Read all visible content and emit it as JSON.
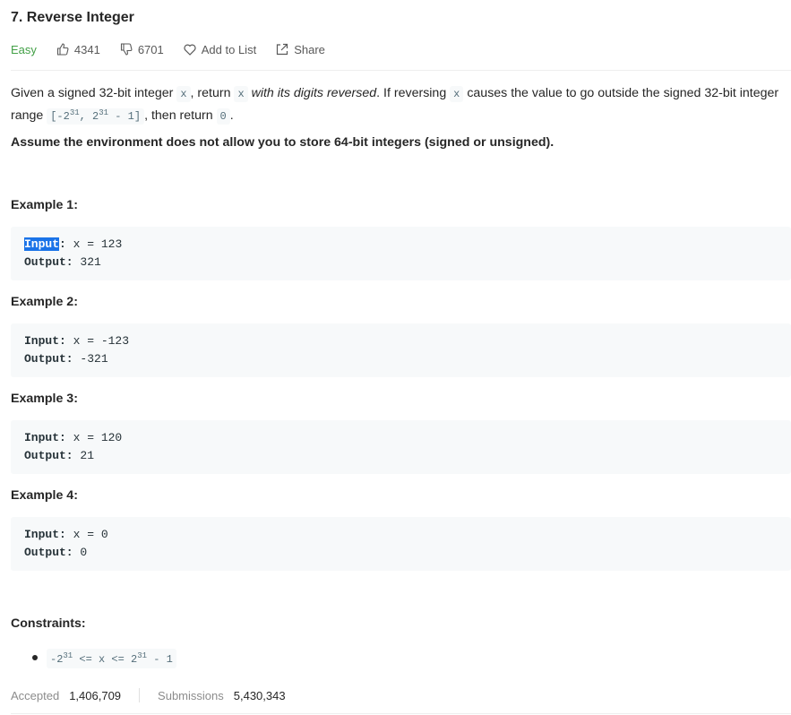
{
  "problem": {
    "title": "7. Reverse Integer",
    "difficulty": "Easy",
    "likes": "4341",
    "dislikes": "6701",
    "add_to_list": "Add to List",
    "share": "Share"
  },
  "description": {
    "p1_a": "Given a signed 32-bit integer ",
    "p1_code1": "x",
    "p1_b": ", return ",
    "p1_code2": "x",
    "p1_em": "with its digits reversed",
    "p1_c": ". If reversing ",
    "p1_code3": "x",
    "p1_d": " causes the value to go outside the signed 32-bit integer range ",
    "range_open": "[-2",
    "range_exp1": "31",
    "range_mid": ", 2",
    "range_exp2": "31",
    "range_close": " - 1]",
    "p1_e": ", then return ",
    "p1_code4": "0",
    "p1_f": ".",
    "assume": "Assume the environment does not allow you to store 64-bit integers (signed or unsigned)."
  },
  "examples": [
    {
      "title": "Example 1:",
      "input_label": "Input",
      "input": "x = 123",
      "output_label": "Output:",
      "output": "321"
    },
    {
      "title": "Example 2:",
      "input_label": "Input:",
      "input": "x = -123",
      "output_label": "Output:",
      "output": "-321"
    },
    {
      "title": "Example 3:",
      "input_label": "Input:",
      "input": "x = 120",
      "output_label": "Output:",
      "output": "21"
    },
    {
      "title": "Example 4:",
      "input_label": "Input:",
      "input": "x = 0",
      "output_label": "Output:",
      "output": "0"
    }
  ],
  "constraints": {
    "title": "Constraints:",
    "c1_a": "-2",
    "c1_exp1": "31",
    "c1_b": " <= x <= 2",
    "c1_exp2": "31",
    "c1_c": " - 1"
  },
  "stats": {
    "accepted_label": "Accepted",
    "accepted_value": "1,406,709",
    "submissions_label": "Submissions",
    "submissions_value": "5,430,343"
  },
  "colors": {
    "easy": "#43a047",
    "highlight": "#1a73e8",
    "code_bg": "#f7f9fa"
  }
}
